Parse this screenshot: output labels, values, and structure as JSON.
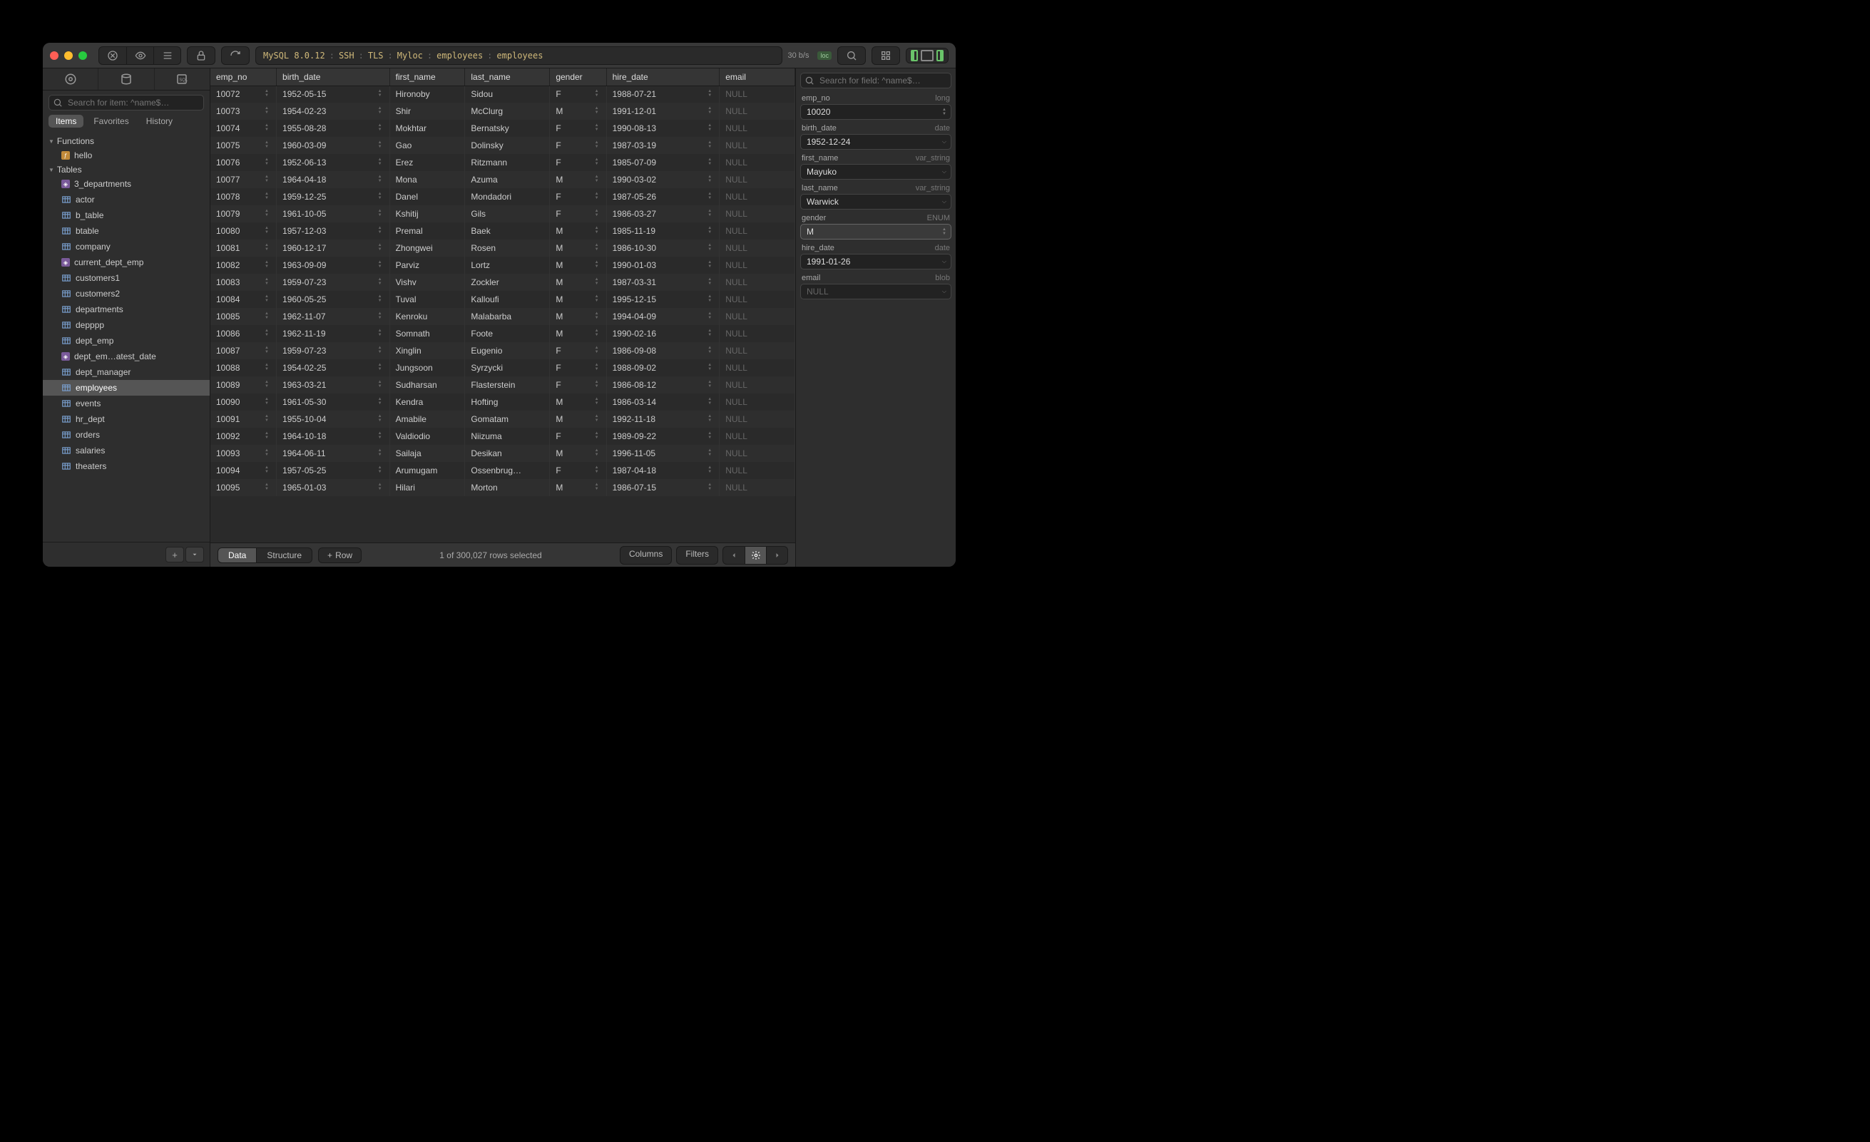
{
  "titlebar": {
    "breadcrumb": [
      "MySQL 8.0.12",
      "SSH",
      "TLS",
      "Myloc",
      "employees",
      "employees"
    ],
    "bandwidth": "30 b/s",
    "loc_badge": "loc"
  },
  "sidebar": {
    "search_placeholder": "Search for item: ^name$…",
    "tabs": [
      "Items",
      "Favorites",
      "History"
    ],
    "active_tab": 0,
    "sections": [
      {
        "title": "Functions",
        "items": [
          {
            "label": "hello",
            "icon": "func"
          }
        ]
      },
      {
        "title": "Tables",
        "items": [
          {
            "label": "3_departments",
            "icon": "view"
          },
          {
            "label": "actor",
            "icon": "table"
          },
          {
            "label": "b_table",
            "icon": "table"
          },
          {
            "label": "btable",
            "icon": "table"
          },
          {
            "label": "company",
            "icon": "table"
          },
          {
            "label": "current_dept_emp",
            "icon": "view"
          },
          {
            "label": "customers1",
            "icon": "table"
          },
          {
            "label": "customers2",
            "icon": "table"
          },
          {
            "label": "departments",
            "icon": "table"
          },
          {
            "label": "depppp",
            "icon": "table"
          },
          {
            "label": "dept_emp",
            "icon": "table"
          },
          {
            "label": "dept_em…atest_date",
            "icon": "view"
          },
          {
            "label": "dept_manager",
            "icon": "table"
          },
          {
            "label": "employees",
            "icon": "table",
            "selected": true
          },
          {
            "label": "events",
            "icon": "table"
          },
          {
            "label": "hr_dept",
            "icon": "table"
          },
          {
            "label": "orders",
            "icon": "table"
          },
          {
            "label": "salaries",
            "icon": "table"
          },
          {
            "label": "theaters",
            "icon": "table"
          }
        ]
      }
    ]
  },
  "table": {
    "columns": [
      "emp_no",
      "birth_date",
      "first_name",
      "last_name",
      "gender",
      "hire_date",
      "email"
    ],
    "rows": [
      [
        "10072",
        "1952-05-15",
        "Hironoby",
        "Sidou",
        "F",
        "1988-07-21",
        "NULL"
      ],
      [
        "10073",
        "1954-02-23",
        "Shir",
        "McClurg",
        "M",
        "1991-12-01",
        "NULL"
      ],
      [
        "10074",
        "1955-08-28",
        "Mokhtar",
        "Bernatsky",
        "F",
        "1990-08-13",
        "NULL"
      ],
      [
        "10075",
        "1960-03-09",
        "Gao",
        "Dolinsky",
        "F",
        "1987-03-19",
        "NULL"
      ],
      [
        "10076",
        "1952-06-13",
        "Erez",
        "Ritzmann",
        "F",
        "1985-07-09",
        "NULL"
      ],
      [
        "10077",
        "1964-04-18",
        "Mona",
        "Azuma",
        "M",
        "1990-03-02",
        "NULL"
      ],
      [
        "10078",
        "1959-12-25",
        "Danel",
        "Mondadori",
        "F",
        "1987-05-26",
        "NULL"
      ],
      [
        "10079",
        "1961-10-05",
        "Kshitij",
        "Gils",
        "F",
        "1986-03-27",
        "NULL"
      ],
      [
        "10080",
        "1957-12-03",
        "Premal",
        "Baek",
        "M",
        "1985-11-19",
        "NULL"
      ],
      [
        "10081",
        "1960-12-17",
        "Zhongwei",
        "Rosen",
        "M",
        "1986-10-30",
        "NULL"
      ],
      [
        "10082",
        "1963-09-09",
        "Parviz",
        "Lortz",
        "M",
        "1990-01-03",
        "NULL"
      ],
      [
        "10083",
        "1959-07-23",
        "Vishv",
        "Zockler",
        "M",
        "1987-03-31",
        "NULL"
      ],
      [
        "10084",
        "1960-05-25",
        "Tuval",
        "Kalloufi",
        "M",
        "1995-12-15",
        "NULL"
      ],
      [
        "10085",
        "1962-11-07",
        "Kenroku",
        "Malabarba",
        "M",
        "1994-04-09",
        "NULL"
      ],
      [
        "10086",
        "1962-11-19",
        "Somnath",
        "Foote",
        "M",
        "1990-02-16",
        "NULL"
      ],
      [
        "10087",
        "1959-07-23",
        "Xinglin",
        "Eugenio",
        "F",
        "1986-09-08",
        "NULL"
      ],
      [
        "10088",
        "1954-02-25",
        "Jungsoon",
        "Syrzycki",
        "F",
        "1988-09-02",
        "NULL"
      ],
      [
        "10089",
        "1963-03-21",
        "Sudharsan",
        "Flasterstein",
        "F",
        "1986-08-12",
        "NULL"
      ],
      [
        "10090",
        "1961-05-30",
        "Kendra",
        "Hofting",
        "M",
        "1986-03-14",
        "NULL"
      ],
      [
        "10091",
        "1955-10-04",
        "Amabile",
        "Gomatam",
        "M",
        "1992-11-18",
        "NULL"
      ],
      [
        "10092",
        "1964-10-18",
        "Valdiodio",
        "Niizuma",
        "F",
        "1989-09-22",
        "NULL"
      ],
      [
        "10093",
        "1964-06-11",
        "Sailaja",
        "Desikan",
        "M",
        "1996-11-05",
        "NULL"
      ],
      [
        "10094",
        "1957-05-25",
        "Arumugam",
        "Ossenbrug…",
        "F",
        "1987-04-18",
        "NULL"
      ],
      [
        "10095",
        "1965-01-03",
        "Hilari",
        "Morton",
        "M",
        "1986-07-15",
        "NULL"
      ]
    ]
  },
  "footer": {
    "view_modes": [
      "Data",
      "Structure"
    ],
    "active_mode": 0,
    "row_button": "Row",
    "status": "1 of 300,027 rows selected",
    "columns_btn": "Columns",
    "filters_btn": "Filters"
  },
  "inspector": {
    "search_placeholder": "Search for field: ^name$…",
    "fields": [
      {
        "name": "emp_no",
        "type": "long",
        "value": "10020",
        "stepper": true
      },
      {
        "name": "birth_date",
        "type": "date",
        "value": "1952-12-24"
      },
      {
        "name": "first_name",
        "type": "var_string",
        "value": "Mayuko"
      },
      {
        "name": "last_name",
        "type": "var_string",
        "value": "Warwick"
      },
      {
        "name": "gender",
        "type": "ENUM",
        "value": "M",
        "highlight": true,
        "stepper": true
      },
      {
        "name": "hire_date",
        "type": "date",
        "value": "1991-01-26"
      },
      {
        "name": "email",
        "type": "blob",
        "value": "NULL",
        "null": true
      }
    ]
  }
}
